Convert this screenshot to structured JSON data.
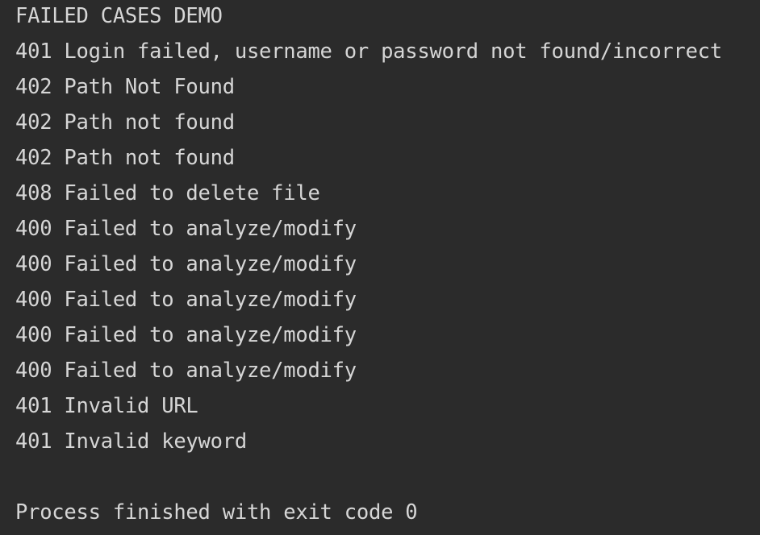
{
  "console": {
    "lines": [
      "FAILED CASES DEMO",
      "401 Login failed, username or password not found/incorrect",
      "402 Path Not Found",
      "402 Path not found",
      "402 Path not found",
      "408 Failed to delete file",
      "400 Failed to analyze/modify",
      "400 Failed to analyze/modify",
      "400 Failed to analyze/modify",
      "400 Failed to analyze/modify",
      "400 Failed to analyze/modify",
      "401 Invalid URL",
      "401 Invalid keyword"
    ],
    "exit_message": "Process finished with exit code 0"
  },
  "colors": {
    "background": "#2b2b2b",
    "text": "#d6d6d6"
  }
}
